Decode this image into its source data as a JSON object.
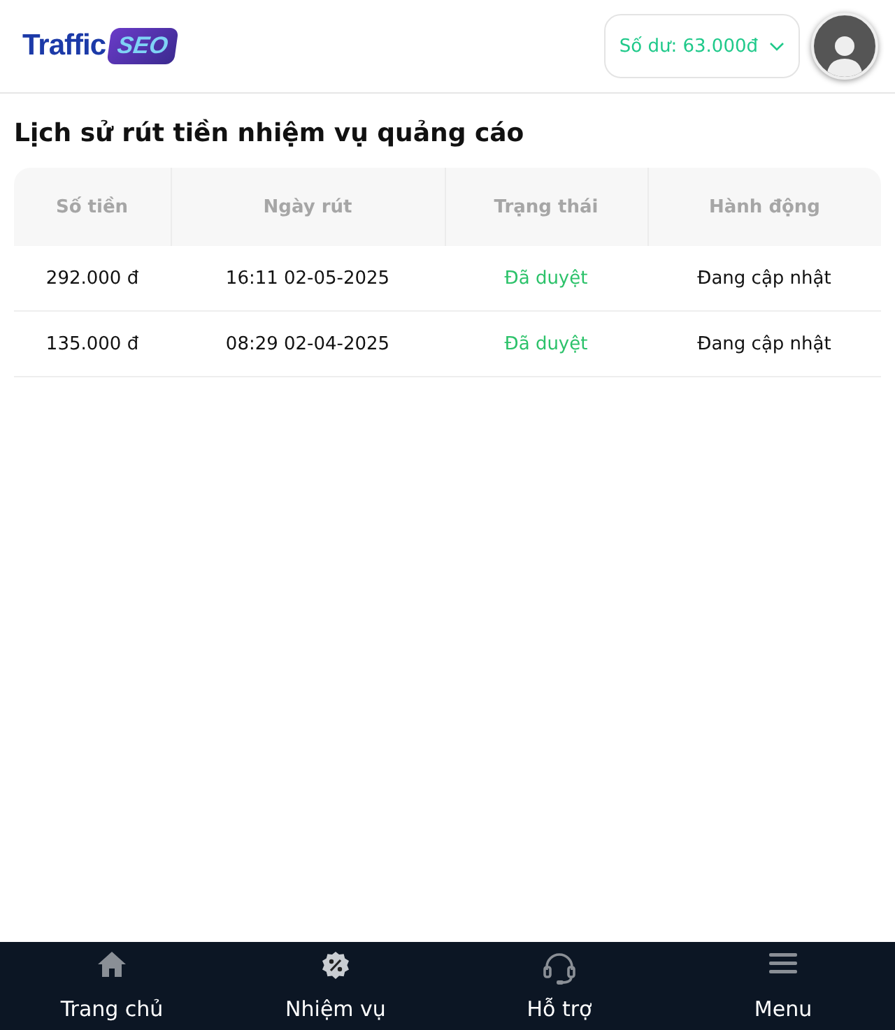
{
  "header": {
    "logo": {
      "text": "Traffic",
      "badge": "SEO"
    },
    "balance": "Số dư: 63.000đ"
  },
  "title": "Lịch sử rút tiền nhiệm vụ quảng cáo",
  "table": {
    "columns": [
      "Số tiền",
      "Ngày rút",
      "Trạng thái",
      "Hành động"
    ],
    "rows": [
      {
        "amount": "292.000 đ",
        "date": "16:11 02-05-2025",
        "status": "Đã duyệt",
        "action": "Đang cập nhật"
      },
      {
        "amount": "135.000 đ",
        "date": "08:29 02-04-2025",
        "status": "Đã duyệt",
        "action": "Đang cập nhật"
      }
    ]
  },
  "bottom_nav": [
    {
      "kind": "home",
      "label": "Trang chủ"
    },
    {
      "kind": "task",
      "label": "Nhiệm vụ"
    },
    {
      "kind": "support",
      "label": "Hỗ trợ"
    },
    {
      "kind": "menu",
      "label": "Menu"
    }
  ]
}
